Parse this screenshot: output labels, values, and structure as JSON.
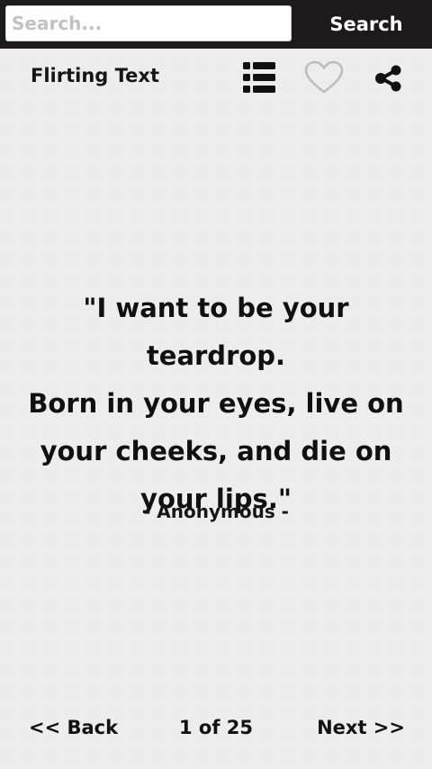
{
  "search": {
    "placeholder": "Search...",
    "value": "",
    "button_label": "Search"
  },
  "header": {
    "title": "Flirting Text",
    "icons": {
      "list": "list-icon",
      "favorite": "heart-outline-icon",
      "share": "share-icon"
    }
  },
  "quote": {
    "text": "\"I want to be your teardrop.\nBorn in your eyes, live on\nyour cheeks, and die on\nyour lips.\"",
    "author": "- Anonymous -"
  },
  "navigation": {
    "back_label": "<< Back",
    "counter": "1 of 25",
    "current_page": 1,
    "total_pages": 25,
    "next_label": "Next >>"
  },
  "colors": {
    "top_bar": "#1d1a1b",
    "background": "#efefef",
    "text": "#111111",
    "heart_outline": "#bdbdbd"
  }
}
